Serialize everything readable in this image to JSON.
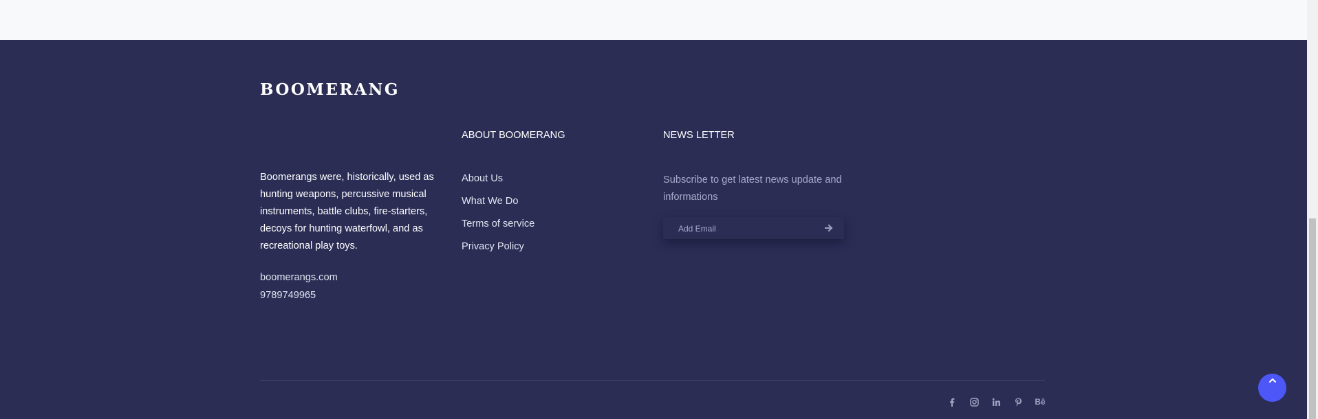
{
  "footer": {
    "brand": "BOOMERANG",
    "about_text": "Boomerangs were, historically, used as hunting weapons, percussive musical instruments, battle clubs, fire-starters, decoys for hunting waterfowl, and as recreational play toys.",
    "contact": {
      "website": "boomerangs.com",
      "phone": "9789749965"
    },
    "about_column": {
      "heading": "ABOUT BOOMERANG",
      "links": [
        {
          "label": "About Us"
        },
        {
          "label": "What We Do"
        },
        {
          "label": "Terms of service"
        },
        {
          "label": "Privacy Policy"
        }
      ]
    },
    "newsletter": {
      "heading": "NEWS LETTER",
      "text": "Subscribe to get latest news update and informations",
      "email_placeholder": "Add Email",
      "submit_icon": "arrow-right-icon"
    },
    "socials": [
      {
        "name": "facebook-icon"
      },
      {
        "name": "instagram-icon"
      },
      {
        "name": "linkedin-icon"
      },
      {
        "name": "pinterest-icon"
      },
      {
        "name": "behance-icon",
        "text": "Bē"
      }
    ]
  },
  "back_to_top": {
    "icon": "chevron-up-icon"
  },
  "colors": {
    "footer_bg": "#2b2d55",
    "top_band_bg": "#f8f9fb",
    "accent": "#4d57f8",
    "muted_text": "#a9abcb"
  }
}
